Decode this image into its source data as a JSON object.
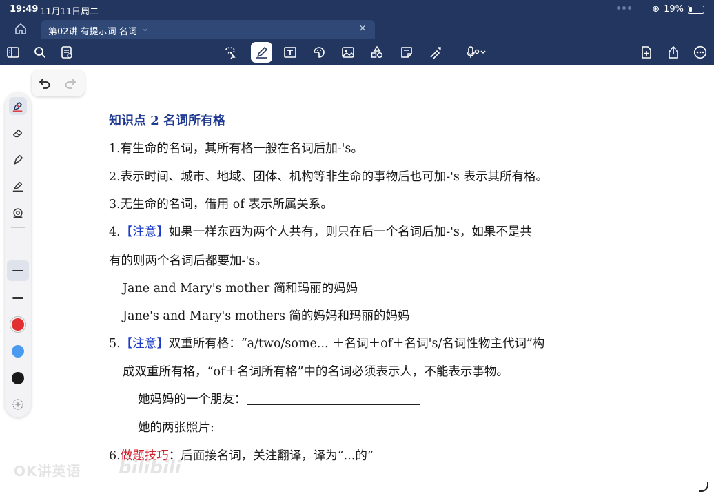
{
  "status": {
    "time": "19:49",
    "date": "11月11日周二",
    "battery": "19%"
  },
  "tab": {
    "title": "第02讲 有提示词 名词",
    "chevron": "⌄",
    "close": "×"
  },
  "toolbar": {
    "icons": [
      "sidebar-icon",
      "search-icon",
      "document-icon",
      "lasso-icon",
      "pen-icon",
      "textbox-icon",
      "sticker-icon",
      "image-icon",
      "shapes-icon",
      "note-icon",
      "laser-pointer-icon",
      "microphone-icon",
      "add-page-icon",
      "share-icon",
      "more-icon"
    ]
  },
  "palette": {
    "colors": {
      "red": "#e23030",
      "blue": "#4a9bf0",
      "black": "#1a1a1a"
    }
  },
  "document": {
    "heading": "知识点 2  名词所有格",
    "l1": "1.有生命的名词，其所有格一般在名词后加-'s。",
    "l2": "2.表示时间、城市、地域、团体、机构等非生命的事物后也可加-'s 表示其所有格。",
    "l3": "3.无生命的名词，借用 of 表示所属关系。",
    "l4_num": "4.",
    "l4_note": "【注意】",
    "l4_text": "如果一样东西为两个人共有，则只在后一个名词后加-'s，如果不是共",
    "l4b": "有的则两个名词后都要加-'s。",
    "ex1": "Jane and Mary's mother  简和玛丽的妈妈",
    "ex2": "Jane's and Mary's mothers  简的妈妈和玛丽的妈妈",
    "l5_num": "5.",
    "l5_note": "【注意】",
    "l5_text": "双重所有格：“a/two/some...  ＋名词＋of＋名词's/名词性物主代词”构",
    "l5b": "成双重所有格，“of＋名词所有格”中的名词必须表示人，不能表示事物。",
    "q1": "她妈妈的一个朋友：",
    "q2": "她的两张照片:",
    "l6_num": "6.",
    "l6_tip": "做题技巧",
    "l6_text": "：后面接名词，关注翻译，译为“...的”"
  },
  "watermark": {
    "left": "OK讲英语",
    "right": "bilibili"
  }
}
